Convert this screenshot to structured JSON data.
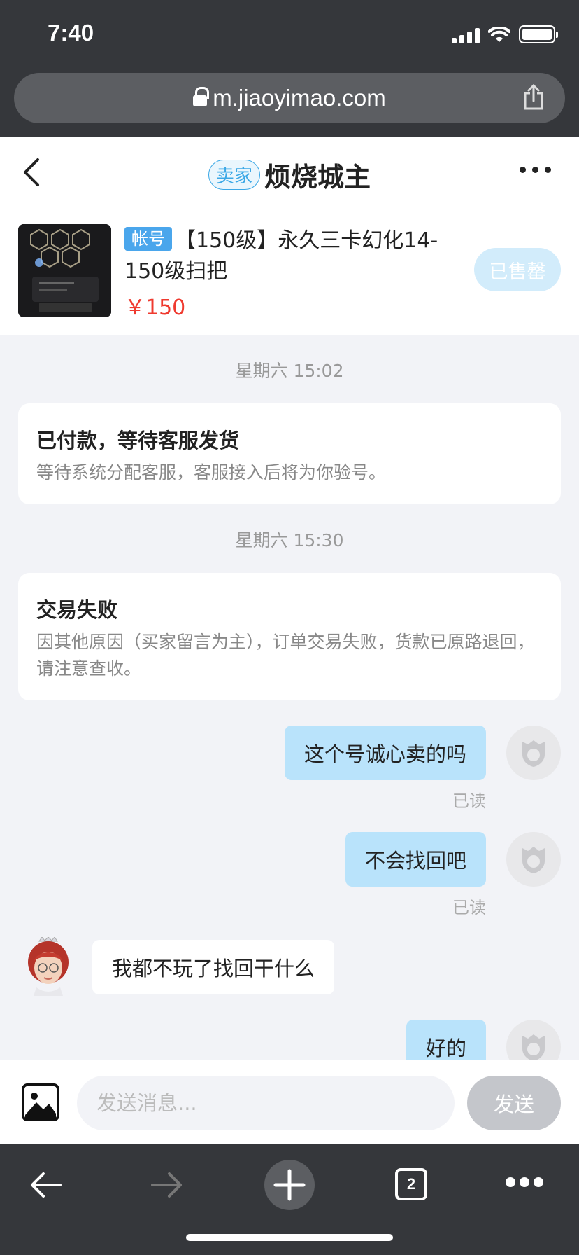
{
  "status_bar": {
    "time": "7:40"
  },
  "browser": {
    "url": "m.jiaoyimao.com",
    "tab_count": "2"
  },
  "header": {
    "badge": "卖家",
    "title": "烦烧城主"
  },
  "product": {
    "tag": "帐号",
    "title": "【150级】永久三卡幻化14-150级扫把",
    "price": "￥150",
    "status_button": "已售罄"
  },
  "messages": {
    "system": [
      {
        "time": "星期六 15:02",
        "title": "已付款，等待客服发货",
        "desc": "等待系统分配客服，客服接入后将为你验号。"
      },
      {
        "time": "星期六 15:30",
        "title": "交易失败",
        "desc": "因其他原因（买家留言为主），订单交易失败，货款已原路退回，请注意查收。"
      }
    ],
    "chat": [
      {
        "from": "me",
        "text": "这个号诚心卖的吗",
        "read": "已读"
      },
      {
        "from": "me",
        "text": "不会找回吧",
        "read": "已读"
      },
      {
        "from": "other",
        "text": "我都不玩了找回干什么"
      },
      {
        "from": "me",
        "text": "好的"
      }
    ]
  },
  "input": {
    "placeholder": "发送消息...",
    "send_label": "发送"
  },
  "colors": {
    "accent": "#3ba8e6",
    "price": "#ef3a2f",
    "my_bubble": "#b9e3fb",
    "chrome": "#35373b"
  }
}
